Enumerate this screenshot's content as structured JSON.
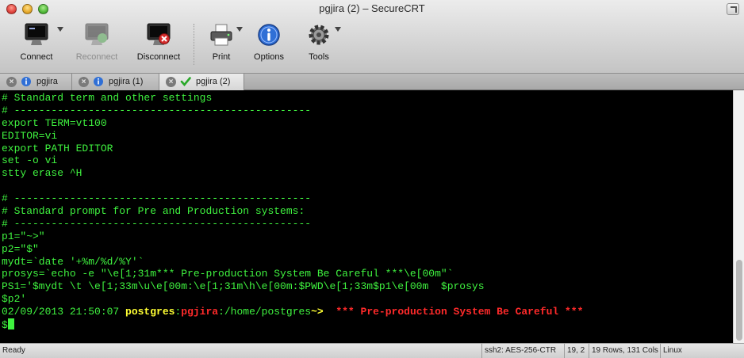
{
  "window": {
    "title": "pgjira (2) – SecureCRT"
  },
  "toolbar": {
    "connect": "Connect",
    "reconnect": "Reconnect",
    "disconnect": "Disconnect",
    "print": "Print",
    "options": "Options",
    "tools": "Tools"
  },
  "tabs": [
    {
      "label": "pgjira",
      "status_icon": "info-icon"
    },
    {
      "label": "pgjira (1)",
      "status_icon": "info-icon"
    },
    {
      "label": "pgjira (2)",
      "status_icon": "checkmark-icon",
      "active": true
    }
  ],
  "terminal": {
    "lines": [
      "# Standard term and other settings",
      "# ------------------------------------------------",
      "export TERM=vt100",
      "EDITOR=vi",
      "export PATH EDITOR",
      "set -o vi",
      "stty erase ^H",
      "",
      "# ------------------------------------------------",
      "# Standard prompt for Pre and Production systems:",
      "# ------------------------------------------------",
      "p1=\"~>\"",
      "p2=\"$\"",
      "mydt=`date '+%m/%d/%Y'`",
      "prosys=`echo -e \"\\e[1;31m*** Pre-production System Be Careful ***\\e[00m\"`",
      "PS1='$mydt \\t \\e[1;33m\\u\\e[00m:\\e[1;31m\\h\\e[00m:$PWD\\e[1;33m$p1\\e[00m  $prosys",
      "$p2'"
    ],
    "prompt": {
      "datetime": "02/09/2013 21:50:07 ",
      "user": "postgres",
      "sep1": ":",
      "host": "pgjira",
      "path": ":/home/postgres",
      "arrow": "~>",
      "gap": "  ",
      "warning": "*** Pre-production System Be Careful ***"
    },
    "prompt2": "$",
    "colors": {
      "background": "#000000",
      "text": "#3ff23f",
      "user": "#ffff33",
      "warning": "#ff2a2a"
    }
  },
  "statusbar": {
    "ready": "Ready",
    "cipher": "ssh2: AES-256-CTR",
    "position": "19,  2",
    "size": "19 Rows, 131 Cols",
    "os": "Linux"
  }
}
